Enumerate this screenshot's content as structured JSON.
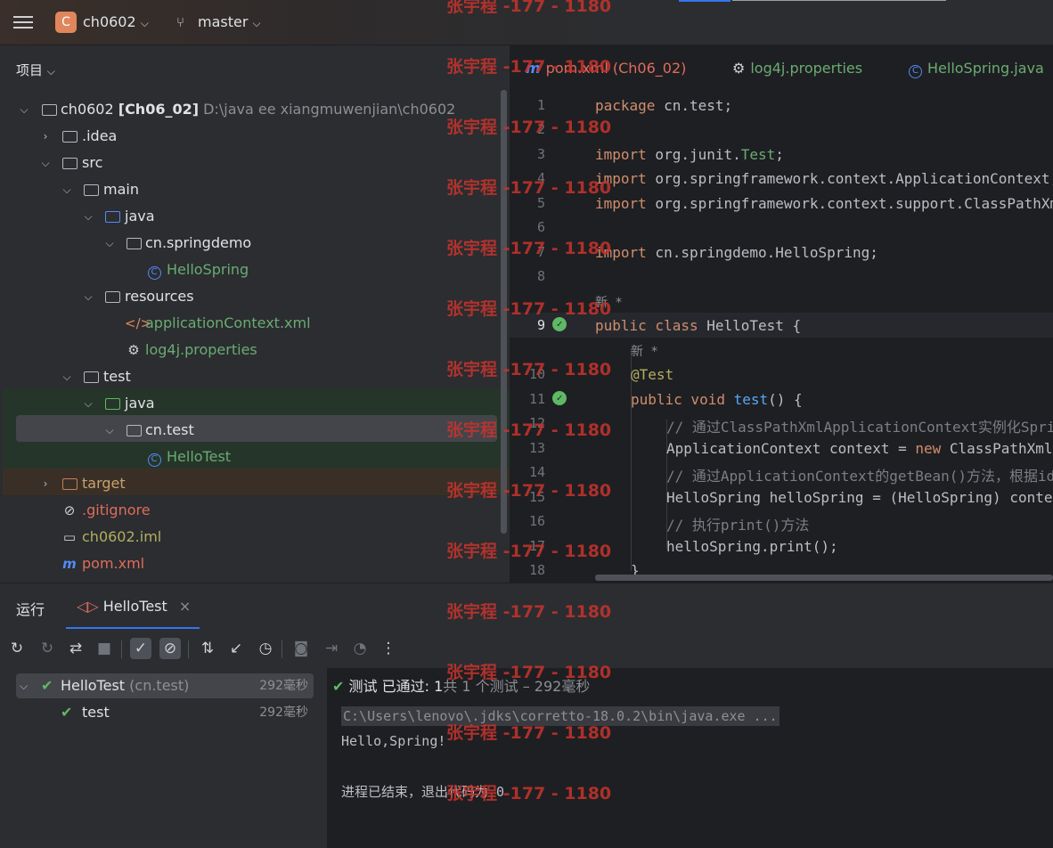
{
  "topbar": {
    "project_badge": "C",
    "project_name": "ch0602",
    "branch": "master"
  },
  "project_panel": {
    "title": "项目",
    "tree": [
      {
        "name": "ch0602",
        "extra": "[Ch06_02]",
        "path": "D:\\java ee xiangmuwenjian\\ch0602"
      },
      {
        "name": ".idea"
      },
      {
        "name": "src"
      },
      {
        "name": "main"
      },
      {
        "name": "java"
      },
      {
        "name": "cn.springdemo"
      },
      {
        "name": "HelloSpring"
      },
      {
        "name": "resources"
      },
      {
        "name": "applicationContext.xml"
      },
      {
        "name": "log4j.properties"
      },
      {
        "name": "test"
      },
      {
        "name": "java"
      },
      {
        "name": "cn.test"
      },
      {
        "name": "HelloTest"
      },
      {
        "name": "target"
      },
      {
        "name": ".gitignore"
      },
      {
        "name": "ch0602.iml"
      },
      {
        "name": "pom.xml"
      }
    ]
  },
  "editor_tabs": [
    {
      "label": "pom.xml (Ch06_02)",
      "icon": "maven-icon"
    },
    {
      "label": "log4j.properties",
      "icon": "gear-icon"
    },
    {
      "label": "HelloSpring.java",
      "icon": "class-icon"
    }
  ],
  "editor": {
    "line_numbers": [
      "1",
      "2",
      "3",
      "4",
      "5",
      "6",
      "7",
      "8",
      "9",
      "10",
      "11",
      "12",
      "13",
      "14",
      "15",
      "16",
      "17",
      "18"
    ],
    "hint_new": "新 *",
    "code": {
      "l1_kw": "package",
      "l1_rest": " cn.test;",
      "l3_kw": "import",
      "l3_a": " org.junit.",
      "l3_b": "Test",
      "l3_c": ";",
      "l4_kw": "import",
      "l4_rest": " org.springframework.context.ApplicationContext;",
      "l5_kw": "import",
      "l5_rest": " org.springframework.context.support.ClassPathXmlApplicationContext;",
      "l7_kw": "import",
      "l7_rest": " cn.springdemo.HelloSpring;",
      "l9_kw": "public class",
      "l9_rest": " HelloTest {",
      "l10": "@Test",
      "l11_kw": "public void",
      "l11_fn": " test",
      "l11_rest": "() {",
      "l12": "// 通过ClassPathXmlApplicationContext实例化Spring的上下文",
      "l13_a": "ApplicationContext context = ",
      "l13_kw": "new",
      "l13_b": " ClassPathXmlApplicationContext(",
      "l14": "// 通过ApplicationContext的getBean()方法，根据id来获取bean",
      "l15": "HelloSpring helloSpring = (HelloSpring) context.getBean(",
      "l16": "// 执行print()方法",
      "l17": "helloSpring.print();",
      "l18": "}"
    }
  },
  "run_panel": {
    "title": "运行",
    "tab_label": "HelloTest",
    "results": [
      {
        "label": "HelloTest",
        "sub": "(cn.test)",
        "duration": "292毫秒"
      },
      {
        "label": "test",
        "duration": "292毫秒"
      }
    ],
    "status_a": "测试 已通过: ",
    "status_b": "1",
    "status_c": "共 1 个测试 – 292毫秒",
    "console": [
      "C:\\Users\\lenovo\\.jdks\\corretto-18.0.2\\bin\\java.exe ...",
      "Hello,Spring!",
      "",
      "进程已结束，退出代码为 0"
    ]
  },
  "watermark": "张宇程 -177 - 1180"
}
